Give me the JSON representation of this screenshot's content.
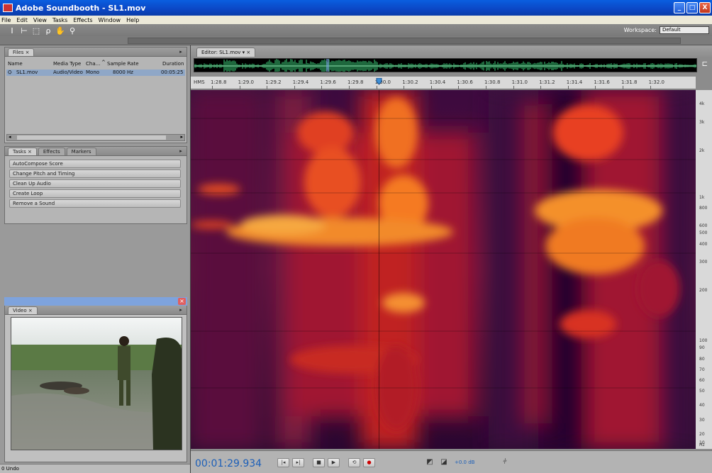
{
  "window": {
    "title": "Adobe Soundbooth - SL1.mov",
    "min": "_",
    "max": "□",
    "close": "X"
  },
  "menu": [
    "File",
    "Edit",
    "View",
    "Tasks",
    "Effects",
    "Window",
    "Help"
  ],
  "toolbar": {
    "workspace_label": "Workspace:",
    "workspace_value": "Default"
  },
  "files_panel": {
    "tab": "Files",
    "columns": [
      "Name",
      "Media Type",
      "Cha...",
      "Sample Rate",
      "Duration"
    ],
    "row": {
      "name": "SL1.mov",
      "media_type": "Audio/Video",
      "channels": "Mono",
      "sample_rate": "8000 Hz",
      "duration": "00:05:25"
    }
  },
  "tasks_panel": {
    "tabs": [
      "Tasks",
      "Effects",
      "Markers"
    ],
    "items": [
      "AutoCompose Score",
      "Change Pitch and Timing",
      "Clean Up Audio",
      "Create Loop",
      "Remove a Sound"
    ]
  },
  "video_panel": {
    "tab": "Video"
  },
  "status": {
    "undo": "0 Undo"
  },
  "editor": {
    "tab": "Editor: SL1.mov",
    "ruler_unit": "HMS",
    "ticks": [
      "1:28.8",
      "1:29.0",
      "1:29.2",
      "1:29.4",
      "1:29.6",
      "1:29.8",
      "1:30.0",
      "1:30.2",
      "1:30.4",
      "1:30.6",
      "1:30.8",
      "1:31.0",
      "1:31.2",
      "1:31.4",
      "1:31.6",
      "1:31.8",
      "1:32.0"
    ],
    "freq_labels": [
      {
        "label": "4k",
        "frac": 0.04
      },
      {
        "label": "3k",
        "frac": 0.09
      },
      {
        "label": "2k",
        "frac": 0.17
      },
      {
        "label": "1k",
        "frac": 0.3
      },
      {
        "label": "800",
        "frac": 0.33
      },
      {
        "label": "600",
        "frac": 0.38
      },
      {
        "label": "500",
        "frac": 0.4
      },
      {
        "label": "400",
        "frac": 0.43
      },
      {
        "label": "300",
        "frac": 0.48
      },
      {
        "label": "200",
        "frac": 0.56
      },
      {
        "label": "100",
        "frac": 0.7
      },
      {
        "label": "90",
        "frac": 0.72
      },
      {
        "label": "80",
        "frac": 0.75
      },
      {
        "label": "70",
        "frac": 0.78
      },
      {
        "label": "60",
        "frac": 0.81
      },
      {
        "label": "50",
        "frac": 0.84
      },
      {
        "label": "40",
        "frac": 0.88
      },
      {
        "label": "30",
        "frac": 0.92
      },
      {
        "label": "20",
        "frac": 0.96
      },
      {
        "label": "10",
        "frac": 0.985
      }
    ],
    "freq_unit": "Hz",
    "playhead_time": "1:29.9"
  },
  "transport": {
    "timecode": "00:01:29.934",
    "volume": "+0.0 dB"
  },
  "colors": {
    "accent_blue": "#1c5fb8",
    "waveform_green": "#3ccf7a",
    "spectro_dark": "#1a0220"
  }
}
